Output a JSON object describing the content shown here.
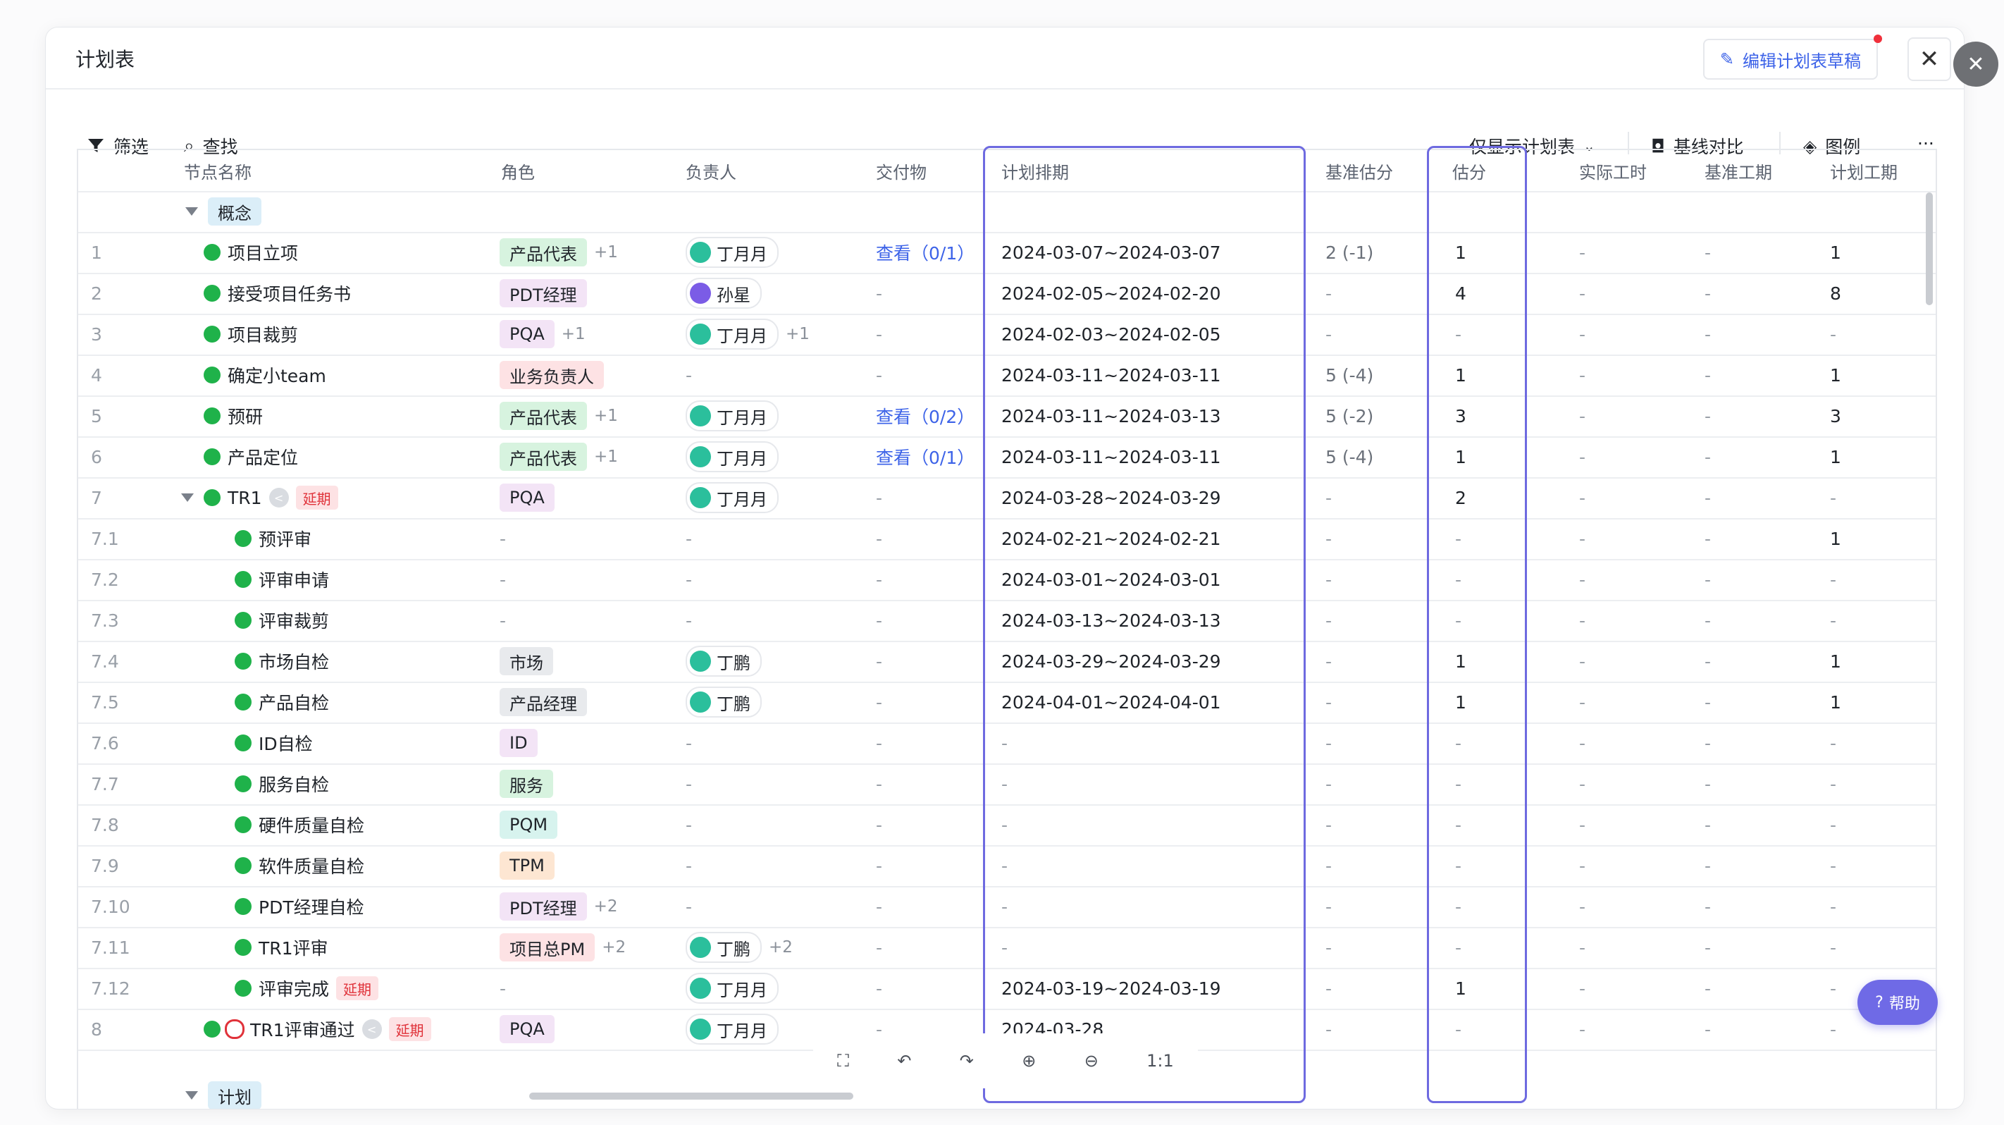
{
  "header": {
    "title": "计划表",
    "edit_label": "编辑计划表草稿"
  },
  "toolbar": {
    "filter": "筛选",
    "search": "查找",
    "view_select": "仅显示计划表",
    "baseline": "基线对比",
    "legend": "图例",
    "more": "···"
  },
  "columns": [
    "节点名称",
    "角色",
    "负责人",
    "交付物",
    "计划排期",
    "基准估分",
    "估分",
    "实际工时",
    "基准工期",
    "计划工期"
  ],
  "group_concept": "概念",
  "group_plan": "计划",
  "rows": [
    {
      "idx": "1",
      "name": "项目立项",
      "role": "产品代表",
      "role_plus": "+1",
      "owner": "丁月月",
      "owner_plus": "",
      "deliv": "查看（0/1）",
      "sched": "2024-03-07~2024-03-07",
      "base_est": "2 (-1)",
      "est": "1",
      "actual": "-",
      "base_dur": "-",
      "plan_dur": "1"
    },
    {
      "idx": "2",
      "name": "接受项目任务书",
      "role": "PDT经理",
      "role_plus": "",
      "owner": "孙星",
      "owner_plus": "",
      "deliv": "-",
      "sched": "2024-02-05~2024-02-20",
      "base_est": "-",
      "est": "4",
      "actual": "-",
      "base_dur": "-",
      "plan_dur": "8"
    },
    {
      "idx": "3",
      "name": "项目裁剪",
      "role": "PQA",
      "role_plus": "+1",
      "owner": "丁月月",
      "owner_plus": "+1",
      "deliv": "-",
      "sched": "2024-02-03~2024-02-05",
      "base_est": "-",
      "est": "-",
      "actual": "-",
      "base_dur": "-",
      "plan_dur": "-"
    },
    {
      "idx": "4",
      "name": "确定小team",
      "role": "业务负责人",
      "role_plus": "",
      "owner": "-",
      "owner_plus": "",
      "deliv": "-",
      "sched": "2024-03-11~2024-03-11",
      "base_est": "5 (-4)",
      "est": "1",
      "actual": "-",
      "base_dur": "-",
      "plan_dur": "1"
    },
    {
      "idx": "5",
      "name": "预研",
      "role": "产品代表",
      "role_plus": "+1",
      "owner": "丁月月",
      "owner_plus": "",
      "deliv": "查看（0/2）",
      "sched": "2024-03-11~2024-03-13",
      "base_est": "5 (-2)",
      "est": "3",
      "actual": "-",
      "base_dur": "-",
      "plan_dur": "3"
    },
    {
      "idx": "6",
      "name": "产品定位",
      "role": "产品代表",
      "role_plus": "+1",
      "owner": "丁月月",
      "owner_plus": "",
      "deliv": "查看（0/1）",
      "sched": "2024-03-11~2024-03-11",
      "base_est": "5 (-4)",
      "est": "1",
      "actual": "-",
      "base_dur": "-",
      "plan_dur": "1"
    },
    {
      "idx": "7",
      "name": "TR1",
      "role": "PQA",
      "role_plus": "",
      "owner": "丁月月",
      "owner_plus": "",
      "deliv": "-",
      "sched": "2024-03-28~2024-03-29",
      "base_est": "-",
      "est": "2",
      "actual": "-",
      "base_dur": "-",
      "plan_dur": "-",
      "delay": "延期"
    },
    {
      "idx": "7.1",
      "name": "预评审",
      "role": "-",
      "role_plus": "",
      "owner": "-",
      "owner_plus": "",
      "deliv": "-",
      "sched": "2024-02-21~2024-02-21",
      "base_est": "-",
      "est": "-",
      "actual": "-",
      "base_dur": "-",
      "plan_dur": "1"
    },
    {
      "idx": "7.2",
      "name": "评审申请",
      "role": "-",
      "role_plus": "",
      "owner": "-",
      "owner_plus": "",
      "deliv": "-",
      "sched": "2024-03-01~2024-03-01",
      "base_est": "-",
      "est": "-",
      "actual": "-",
      "base_dur": "-",
      "plan_dur": "-"
    },
    {
      "idx": "7.3",
      "name": "评审裁剪",
      "role": "-",
      "role_plus": "",
      "owner": "-",
      "owner_plus": "",
      "deliv": "-",
      "sched": "2024-03-13~2024-03-13",
      "base_est": "-",
      "est": "-",
      "actual": "-",
      "base_dur": "-",
      "plan_dur": "-"
    },
    {
      "idx": "7.4",
      "name": "市场自检",
      "role": "市场",
      "role_plus": "",
      "owner": "丁鹏",
      "owner_plus": "",
      "deliv": "-",
      "sched": "2024-03-29~2024-03-29",
      "base_est": "-",
      "est": "1",
      "actual": "-",
      "base_dur": "-",
      "plan_dur": "1"
    },
    {
      "idx": "7.5",
      "name": "产品自检",
      "role": "产品经理",
      "role_plus": "",
      "owner": "丁鹏",
      "owner_plus": "",
      "deliv": "-",
      "sched": "2024-04-01~2024-04-01",
      "base_est": "-",
      "est": "1",
      "actual": "-",
      "base_dur": "-",
      "plan_dur": "1"
    },
    {
      "idx": "7.6",
      "name": "ID自检",
      "role": "ID",
      "role_plus": "",
      "owner": "-",
      "owner_plus": "",
      "deliv": "-",
      "sched": "-",
      "base_est": "-",
      "est": "-",
      "actual": "-",
      "base_dur": "-",
      "plan_dur": "-"
    },
    {
      "idx": "7.7",
      "name": "服务自检",
      "role": "服务",
      "role_plus": "",
      "owner": "-",
      "owner_plus": "",
      "deliv": "-",
      "sched": "-",
      "base_est": "-",
      "est": "-",
      "actual": "-",
      "base_dur": "-",
      "plan_dur": "-"
    },
    {
      "idx": "7.8",
      "name": "硬件质量自检",
      "role": "PQM",
      "role_plus": "",
      "owner": "-",
      "owner_plus": "",
      "deliv": "-",
      "sched": "-",
      "base_est": "-",
      "est": "-",
      "actual": "-",
      "base_dur": "-",
      "plan_dur": "-"
    },
    {
      "idx": "7.9",
      "name": "软件质量自检",
      "role": "TPM",
      "role_plus": "",
      "owner": "-",
      "owner_plus": "",
      "deliv": "-",
      "sched": "-",
      "base_est": "-",
      "est": "-",
      "actual": "-",
      "base_dur": "-",
      "plan_dur": "-"
    },
    {
      "idx": "7.10",
      "name": "PDT经理自检",
      "role": "PDT经理",
      "role_plus": "+2",
      "owner": "-",
      "owner_plus": "",
      "deliv": "-",
      "sched": "-",
      "base_est": "-",
      "est": "-",
      "actual": "-",
      "base_dur": "-",
      "plan_dur": "-"
    },
    {
      "idx": "7.11",
      "name": "TR1评审",
      "role": "项目总PM",
      "role_plus": "+2",
      "owner": "丁鹏",
      "owner_plus": "+2",
      "deliv": "-",
      "sched": "-",
      "base_est": "-",
      "est": "-",
      "actual": "-",
      "base_dur": "-",
      "plan_dur": "-"
    },
    {
      "idx": "7.12",
      "name": "评审完成",
      "role": "-",
      "role_plus": "",
      "owner": "丁月月",
      "owner_plus": "",
      "deliv": "-",
      "sched": "2024-03-19~2024-03-19",
      "base_est": "-",
      "est": "1",
      "actual": "-",
      "base_dur": "-",
      "plan_dur": "-",
      "delay": "延期"
    },
    {
      "idx": "8",
      "name": "TR1评审通过",
      "role": "PQA",
      "role_plus": "",
      "owner": "丁月月",
      "owner_plus": "",
      "deliv": "-",
      "sched": "2024-03-28",
      "base_est": "-",
      "est": "-",
      "actual": "-",
      "base_dur": "-",
      "plan_dur": "-",
      "delay": "延期"
    }
  ],
  "zoom": {
    "reset": "1:1"
  },
  "help": {
    "label": "帮助"
  },
  "colors": {
    "accent": "#3d63e8",
    "highlight": "#6e6ae0",
    "done": "#1fb24a",
    "delay": "#e0323a"
  }
}
